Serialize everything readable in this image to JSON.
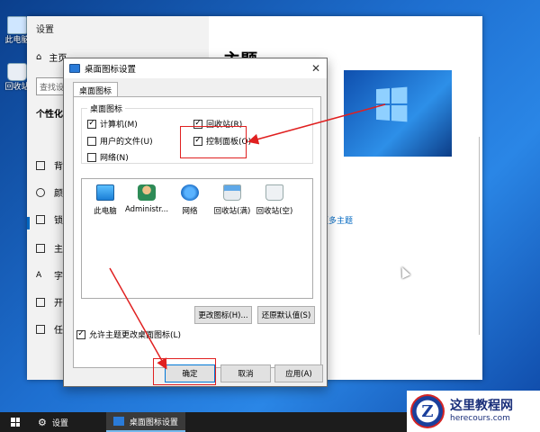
{
  "desktop": {
    "icons": [
      {
        "label": "此电脑"
      },
      {
        "label": "回收站"
      }
    ]
  },
  "settings_window": {
    "title": "设置",
    "controls": [
      "—",
      "☐",
      "✕"
    ],
    "nav": {
      "home": "主页",
      "search_placeholder": "查找设",
      "section": "个性化",
      "items": [
        {
          "label": "背",
          "icon": "image-icon"
        },
        {
          "label": "颜",
          "icon": "palette-icon"
        },
        {
          "label": "锁",
          "icon": "lock-screen-icon"
        },
        {
          "label": "主",
          "icon": "theme-icon",
          "active": true
        },
        {
          "label": "字",
          "icon": "font-icon"
        },
        {
          "label": "开",
          "icon": "start-icon"
        },
        {
          "label": "任",
          "icon": "taskbar-icon"
        }
      ]
    },
    "page_title": "主题",
    "more_themes_link": "更多主题"
  },
  "dialog": {
    "title": "桌面图标设置",
    "tab": "桌面图标",
    "group_title": "桌面图标",
    "checkboxes": [
      {
        "label": "计算机(M)",
        "checked": true
      },
      {
        "label": "回收站(R)",
        "checked": true
      },
      {
        "label": "用户的文件(U)",
        "checked": false
      },
      {
        "label": "控制面板(O)",
        "checked": true
      },
      {
        "label": "网络(N)",
        "checked": false
      }
    ],
    "icon_list": [
      {
        "label": "此电脑",
        "icon": "computer-icon"
      },
      {
        "label": "Administr...",
        "icon": "user-folder-icon"
      },
      {
        "label": "网络",
        "icon": "network-icon"
      },
      {
        "label": "回收站(满)",
        "icon": "recycle-bin-full-icon"
      },
      {
        "label": "回收站(空)",
        "icon": "recycle-bin-empty-icon"
      }
    ],
    "change_icon_button": "更改图标(H)...",
    "restore_default_button": "还原默认值(S)",
    "allow_themes": {
      "label": "允许主题更改桌面图标(L)",
      "checked": true
    },
    "ok_button": "确定",
    "cancel_button": "取消",
    "apply_button": "应用(A)"
  },
  "taskbar": {
    "items": [
      {
        "label": "设置"
      },
      {
        "label": "桌面图标设置"
      }
    ]
  },
  "watermark": {
    "logo_letter": "Z",
    "title": "这里教程网",
    "url": "herecours.com"
  },
  "colors": {
    "annotation": "#e02020",
    "accent": "#0067c0",
    "taskbar": "#1c1c1c"
  }
}
